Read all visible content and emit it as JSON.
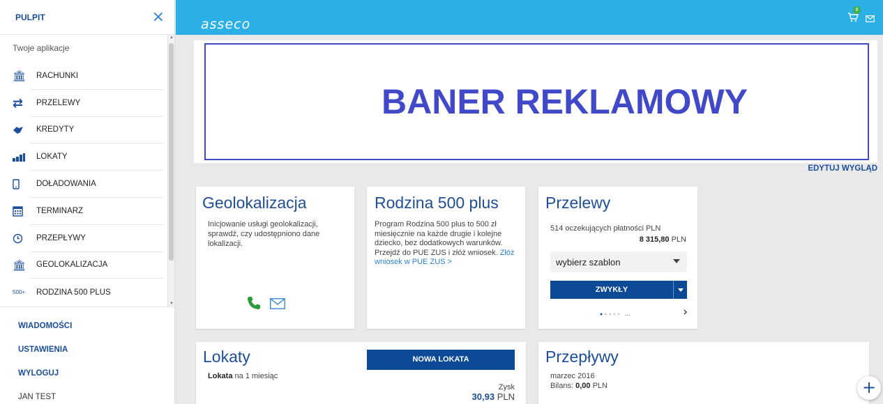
{
  "sidebar": {
    "title": "PULPIT",
    "close_icon": "×",
    "apps_caption": "Twoje aplikacje",
    "items": [
      {
        "label": "RACHUNKI",
        "icon": "bank-icon",
        "glyph": "🏛"
      },
      {
        "label": "PRZELEWY",
        "icon": "transfer-arrows-icon",
        "glyph": "⇄"
      },
      {
        "label": "KREDYTY",
        "icon": "handshake-icon",
        "glyph": "◆"
      },
      {
        "label": "LOKATY",
        "icon": "coins-icon",
        "glyph": "▮"
      },
      {
        "label": "DOŁADOWANIA",
        "icon": "mobile-phone-icon",
        "glyph": "▯"
      },
      {
        "label": "TERMINARZ",
        "icon": "calendar-icon",
        "glyph": "▦"
      },
      {
        "label": "PRZEPŁYWY",
        "icon": "clock-icon",
        "glyph": "◷"
      },
      {
        "label": "GEOLOKALIZACJA",
        "icon": "bank-icon",
        "glyph": "🏛"
      },
      {
        "label": "RODZINA 500 PLUS",
        "icon": "500-plus-icon",
        "glyph": "500+"
      }
    ],
    "links": {
      "messages": "WIADOMOŚCI",
      "settings": "USTAWIENIA",
      "logout": "WYLOGUJ"
    },
    "user": "JAN TEST"
  },
  "topbar": {
    "logo": "asseco",
    "cart_badge": "8",
    "accent_color": "#2bb0e5"
  },
  "banner": {
    "text": "BANER REKLAMOWY",
    "color": "#4149c9"
  },
  "edit_label": "EDYTUJ WYGLĄD",
  "geo": {
    "title": "Geolokalizacja",
    "desc": "Inicjowanie usługi geolokalizacji, sprawdź, czy udostępniono dane lokalizacji."
  },
  "rodzina": {
    "title": "Rodzina 500 plus",
    "desc": "Program Rodzina 500 plus to 500 zł miesięcznie na każde drugie i kolejne dziecko, bez dodatkowych warunków. Przejdź do PUE ZUS i złóż wniosek.",
    "link": "Złóż wniosek w PUE ZUS >"
  },
  "przelewy": {
    "title": "Przelewy",
    "pending": "514 oczekujących płatności PLN",
    "amount": "8 315,80",
    "currency": "PLN",
    "template_select": "wybierz szablon",
    "button": "ZWYKŁY",
    "pager_ellipsis": "..."
  },
  "lokaty": {
    "title": "Lokaty",
    "sub_bold": "Lokata",
    "sub_rest": " na 1 miesiąc",
    "new_button": "NOWA LOKATA",
    "profit_label": "Zysk",
    "profit_value": "30,93",
    "currency": "PLN"
  },
  "przeplywy": {
    "title": "Przepływy",
    "month": "marzec 2016",
    "balance_label": "Bilans: ",
    "balance_value": "0,00",
    "currency": "PLN"
  },
  "fab": "+"
}
